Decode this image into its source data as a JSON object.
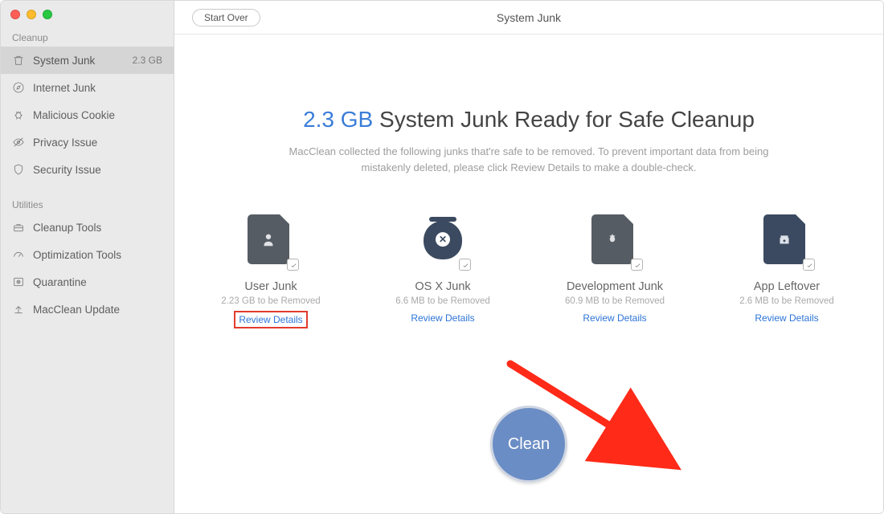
{
  "window": {
    "title": "System Junk",
    "start_over_label": "Start Over"
  },
  "sidebar": {
    "sections": {
      "cleanup": {
        "label": "Cleanup"
      },
      "utilities": {
        "label": "Utilities"
      }
    },
    "items": {
      "system_junk": {
        "label": "System Junk",
        "size": "2.3 GB"
      },
      "internet_junk": {
        "label": "Internet Junk"
      },
      "malicious_cookie": {
        "label": "Malicious Cookie"
      },
      "privacy_issue": {
        "label": "Privacy Issue"
      },
      "security_issue": {
        "label": "Security Issue"
      },
      "cleanup_tools": {
        "label": "Cleanup Tools"
      },
      "optimization_tools": {
        "label": "Optimization Tools"
      },
      "quarantine": {
        "label": "Quarantine"
      },
      "macclean_update": {
        "label": "MacClean Update"
      }
    }
  },
  "headline": {
    "highlight": "2.3 GB",
    "rest": " System Junk Ready for Safe Cleanup"
  },
  "subtext": "MacClean collected the following junks that're safe to be removed. To prevent important data from being mistakenly deleted, please click Review Details to make a double-check.",
  "cards": {
    "user_junk": {
      "title": "User Junk",
      "sub": "2.23 GB to be Removed",
      "review": "Review Details"
    },
    "osx_junk": {
      "title": "OS X Junk",
      "sub": "6.6 MB to be Removed",
      "review": "Review Details"
    },
    "development_junk": {
      "title": "Development Junk",
      "sub": "60.9 MB to be Removed",
      "review": "Review Details"
    },
    "app_leftover": {
      "title": "App Leftover",
      "sub": "2.6 MB to be Removed",
      "review": "Review Details"
    }
  },
  "clean_button": "Clean"
}
